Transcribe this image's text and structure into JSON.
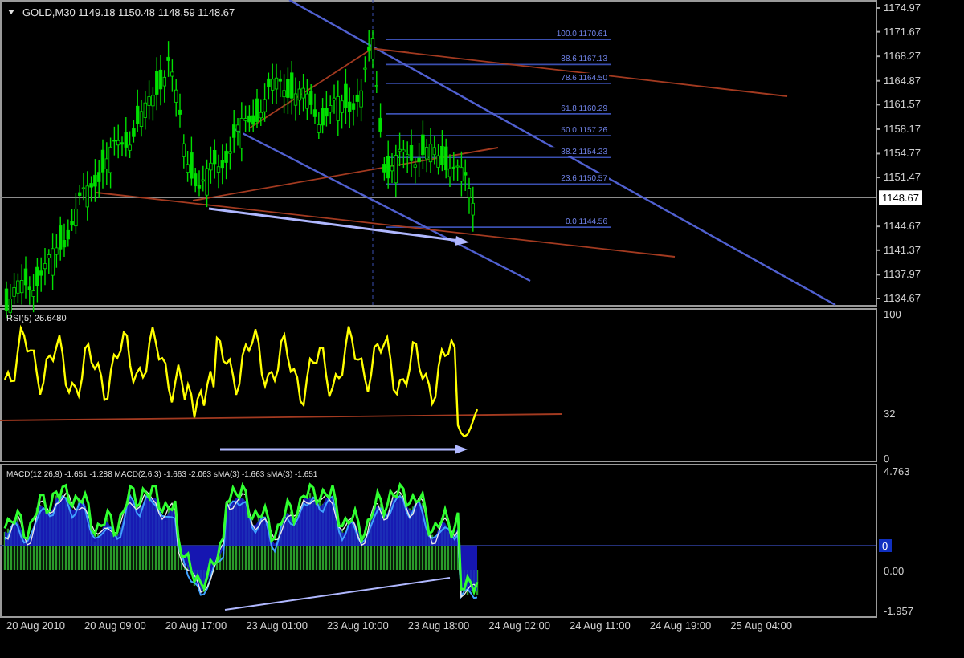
{
  "chart": {
    "title": "GOLD,M30  1149.18 1150.48 1148.59 1148.67",
    "price_axis": [
      "1174.97",
      "1171.67",
      "1168.27",
      "1164.87",
      "1161.57",
      "1158.17",
      "1154.77",
      "1151.47",
      "1144.67",
      "1141.37",
      "1137.97",
      "1134.67"
    ],
    "current_price": "1148.67",
    "fib_levels": [
      "100.0  1170.61",
      "88.6  1167.13",
      "78.6  1164.50",
      "61.8  1160.29",
      "50.0  1157.26",
      "38.2  1154.23",
      "23.6  1150.57",
      "0.0  1144.56"
    ]
  },
  "rsi": {
    "label": "RSI(5) 26.6480",
    "axis": [
      "100",
      "32",
      "0"
    ]
  },
  "macd": {
    "label": "MACD(12,26,9) -1.651 -1.288  MACD(2,6,3) -1.663 -2.063  sMA(3) -1.663  sMA(3) -1.651",
    "axis": [
      "4.763",
      "0.00",
      "-1.957"
    ],
    "level_marker": "0"
  },
  "time_axis": [
    "20 Aug 2010",
    "20 Aug 09:00",
    "20 Aug 17:00",
    "23 Aug 01:00",
    "23 Aug 10:00",
    "23 Aug 18:00",
    "24 Aug 02:00",
    "24 Aug 11:00",
    "24 Aug 19:00",
    "25 Aug 04:00"
  ]
}
